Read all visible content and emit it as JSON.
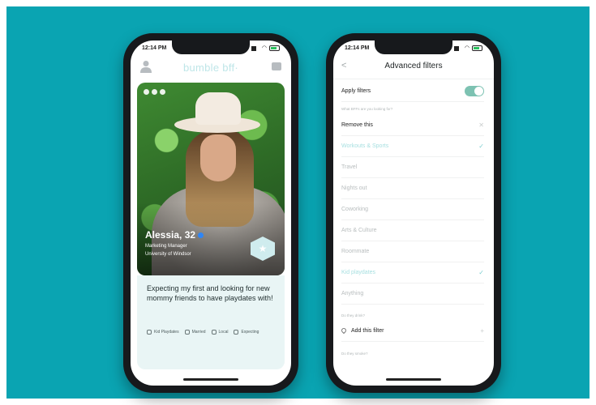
{
  "phone1": {
    "status_time": "12:14 PM",
    "brand": "bumble bff·",
    "profile": {
      "name": "Alessia, 32",
      "job": "Marketing Manager",
      "school": "University of Windsor",
      "badge_icon": "star"
    },
    "bio": "Expecting my first and looking for new mommy friends to have playdates with!",
    "tags": [
      {
        "icon": "search-icon",
        "label": "Kid Playdates"
      },
      {
        "icon": "heart-icon",
        "label": "Married"
      },
      {
        "icon": "globe-icon",
        "label": "Local"
      },
      {
        "icon": "stroller-icon",
        "label": "Expecting"
      }
    ]
  },
  "phone2": {
    "status_time": "12:14 PM",
    "title": "Advanced filters",
    "apply_filters_label": "Apply filters",
    "apply_filters_on": true,
    "question1": "What BFFs are you looking for?",
    "options": [
      {
        "label": "Remove this",
        "state": "remove"
      },
      {
        "label": "Workouts & Sports",
        "state": "selected"
      },
      {
        "label": "Travel",
        "state": "none"
      },
      {
        "label": "Nights out",
        "state": "none"
      },
      {
        "label": "Coworking",
        "state": "none"
      },
      {
        "label": "Arts & Culture",
        "state": "none"
      },
      {
        "label": "Roommate",
        "state": "none"
      },
      {
        "label": "Kid playdates",
        "state": "selected"
      },
      {
        "label": "Anything",
        "state": "none"
      }
    ],
    "question2": "Do they drink?",
    "add_filter_label": "Add this filter",
    "question3": "Do they smoke?"
  },
  "colors": {
    "background": "#0aa4b2",
    "accent_teal": "#7fcfd0",
    "toggle_on": "#7dc2b2",
    "bio_bg": "#e9f5f5"
  }
}
